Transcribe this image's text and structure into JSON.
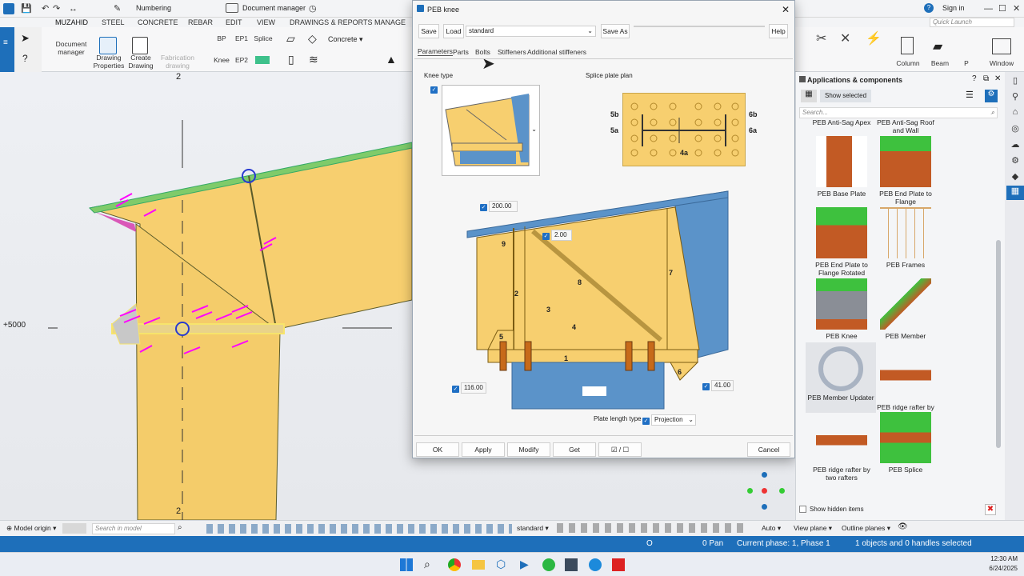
{
  "quickbar": {
    "numbering": "Numbering",
    "document_manager": "Document manager"
  },
  "account": {
    "signin": "Sign in",
    "quick_launch": "Quick Launch"
  },
  "menu": [
    "MUZAHID",
    "STEEL",
    "CONCRETE",
    "REBAR",
    "EDIT",
    "VIEW",
    "DRAWINGS & REPORTS",
    "MANAGE"
  ],
  "menu_selected": "MUZAHID",
  "ribbon": {
    "document_manager": "Document manager",
    "drawing_properties": "Drawing Properties",
    "create_drawing": "Create Drawing",
    "fabrication_drawing": "Fabrication drawing",
    "bp": "BP",
    "ep1": "EP1",
    "splice": "Splice",
    "knee": "Knee",
    "ep2": "EP2",
    "concrete": "Concrete",
    "column": "Column",
    "beam": "Beam",
    "p": "P",
    "window": "Window"
  },
  "model": {
    "grid_label_top": "2",
    "grid_label_bottom": "2",
    "elevation": "+5000"
  },
  "dialog": {
    "title": "PEB knee",
    "save": "Save",
    "load": "Load",
    "preset": "standard",
    "save_as": "Save As",
    "save_as_value": "",
    "help": "Help",
    "tabs": [
      "Parameters",
      "Parts",
      "Bolts",
      "Stiffeners",
      "Additional stiffeners"
    ],
    "active_tab": "Parameters",
    "knee_type_label": "Knee type",
    "splice_plate_plan_label": "Splice plate plan",
    "splice_labels": {
      "l5b": "5b",
      "l5a": "5a",
      "r6b": "6b",
      "r6a": "6a",
      "c4a": "4a"
    },
    "dim_200": "200.00",
    "dim_2": "2.00",
    "dim_116": "116.00",
    "dim_41": "41.00",
    "part_labels": [
      "9",
      "2",
      "8",
      "3",
      "7",
      "4",
      "5",
      "1",
      "6"
    ],
    "plate_length_type_label": "Plate length type",
    "plate_length_type_value": "Projection",
    "ok": "OK",
    "apply": "Apply",
    "modify": "Modify",
    "get": "Get",
    "toggle": "☑ / ☐",
    "cancel": "Cancel"
  },
  "apps": {
    "title": "Applications & components",
    "show_selected": "Show selected",
    "search_placeholder": "Search...",
    "top_items": [
      "PEB Anti-Sag Apex",
      "PEB Anti-Sag Roof and Wall"
    ],
    "items": [
      {
        "label": "PEB Base Plate",
        "icon": "base-plate"
      },
      {
        "label": "PEB End Plate to Flange",
        "icon": "end-plate"
      },
      {
        "label": "PEB End Plate to Flange Rotated",
        "icon": "end-plate-rotated"
      },
      {
        "label": "PEB Frames",
        "icon": "frames"
      },
      {
        "label": "PEB Knee",
        "icon": "knee"
      },
      {
        "label": "PEB Member",
        "icon": "member"
      },
      {
        "label": "PEB Member Updater",
        "icon": "updater"
      },
      {
        "label": "PEB ridge rafter by three points",
        "icon": "ridge-three"
      },
      {
        "label": "PEB ridge rafter by two rafters",
        "icon": "ridge-two"
      },
      {
        "label": "PEB Splice",
        "icon": "splice"
      }
    ],
    "show_hidden": "Show hidden items"
  },
  "statusbar": {
    "model_origin": "Model origin",
    "search_model": "Search in model",
    "preset": "standard",
    "auto": "Auto",
    "view_plane": "View plane",
    "outline_planes": "Outline planes"
  },
  "bluebar": {
    "o": "O",
    "pan": "0 Pan",
    "phase": "Current phase: 1, Phase 1",
    "selection": "1 objects and 0 handles selected"
  },
  "taskbar": {
    "time": "12:30 AM",
    "date": "6/24/2025"
  },
  "colors": {
    "accent": "#1e6fba",
    "plate": "#f7cf6f",
    "member_blue": "#5b93c9",
    "magenta": "#ff00ff"
  }
}
